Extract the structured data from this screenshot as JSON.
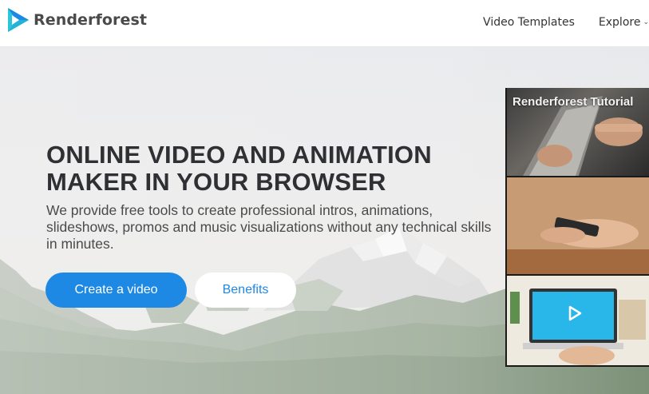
{
  "header": {
    "brand": "Renderforest",
    "nav": [
      {
        "label": "Video Templates"
      },
      {
        "label": "Explore"
      }
    ]
  },
  "hero": {
    "title_line1": "ONLINE VIDEO AND ANIMATION",
    "title_line2": "MAKER IN YOUR BROWSER",
    "subtitle": "We provide free tools to create professional intros, animations, slideshows, promos and music visualizations without any technical skills in minutes.",
    "primary_button": "Create a video",
    "secondary_button": "Benefits"
  },
  "video": {
    "title": "Renderforest Tutorial"
  },
  "colors": {
    "accent": "#1e88e5",
    "logo_cyan": "#27c7d9",
    "logo_blue": "#1e88e5",
    "text_dark": "#2f3033"
  },
  "icons": {
    "logo": "renderforest-play-logo-icon",
    "explore_chevron": "chevron-down-icon",
    "video_play": "play-icon"
  }
}
